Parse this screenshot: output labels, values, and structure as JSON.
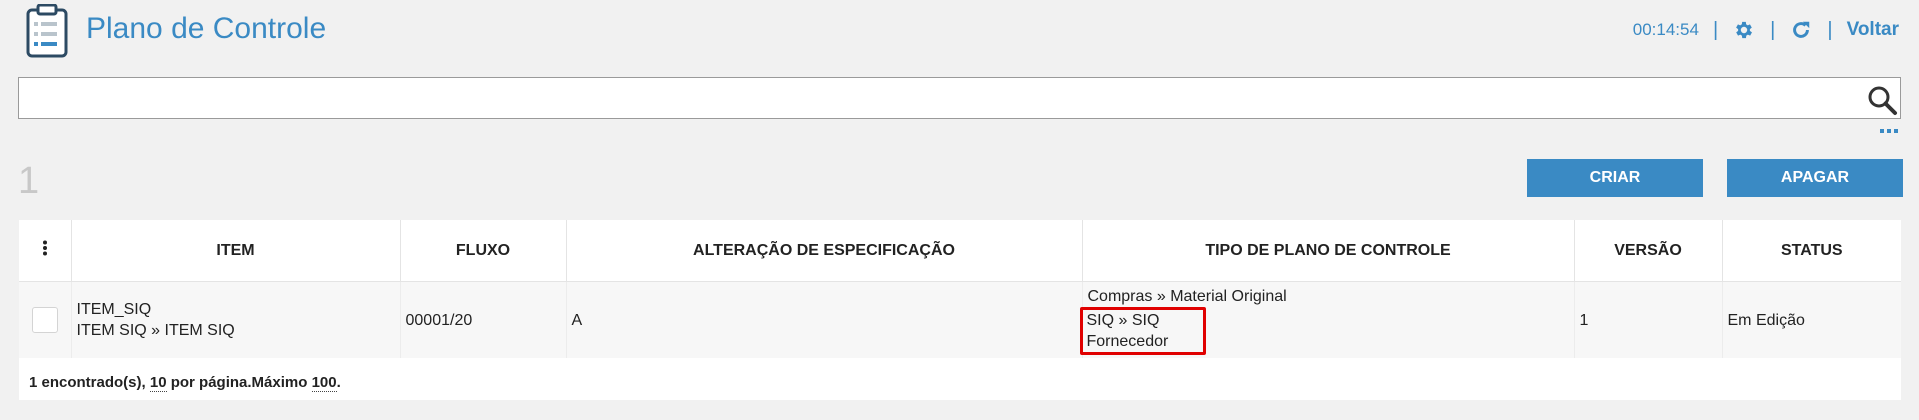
{
  "header": {
    "title": "Plano de Controle",
    "timer": "00:14:54",
    "separator": "|",
    "back_label": "Voltar",
    "accent_color": "#3a8ac4"
  },
  "search": {
    "value": "",
    "placeholder": ""
  },
  "toolbar": {
    "count": "1",
    "create_label": "CRIAR",
    "delete_label": "APAGAR"
  },
  "table": {
    "columns": [
      "ITEM",
      "FLUXO",
      "ALTERAÇÃO DE ESPECIFICAÇÃO",
      "TIPO DE PLANO DE CONTROLE",
      "VERSÃO",
      "STATUS"
    ],
    "rows": [
      {
        "item_code": "ITEM_SIQ",
        "item_path": "ITEM SIQ » ITEM SIQ",
        "fluxo": "00001/20",
        "alteracao": "A",
        "tipo_line1": "Compras » Material Original",
        "tipo_line2": "SIQ » SIQ",
        "tipo_line3": "Fornecedor",
        "versao": "1",
        "status": "Em Edição"
      }
    ]
  },
  "footer": {
    "found_text": "1 encontrado(s), ",
    "per_page_value": "10",
    "per_page_text": " por página.Máximo ",
    "max_value": "100",
    "period": "."
  },
  "icons": [
    "clipboard-icon",
    "gear-icon",
    "refresh-icon",
    "search-icon",
    "more-icon",
    "kebab-menu-icon"
  ]
}
